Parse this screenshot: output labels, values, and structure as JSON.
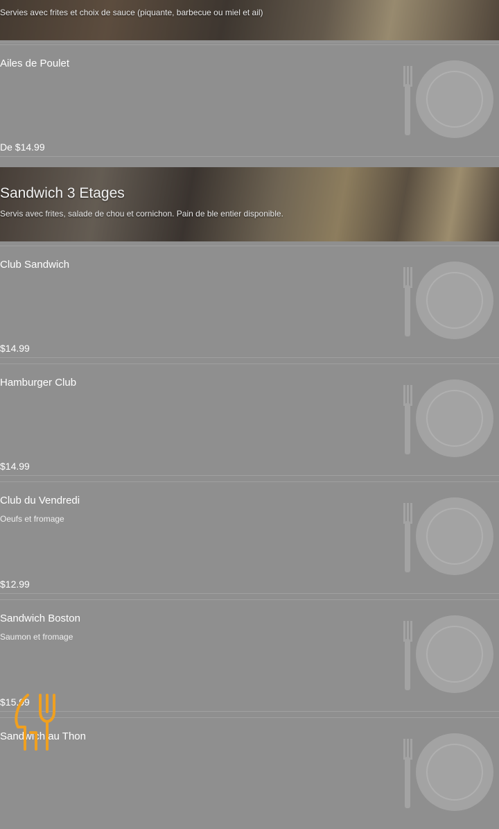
{
  "categories": [
    {
      "title": "",
      "description": "Servies avec frites et choix de sauce (piquante, barbecue ou miel et ail)"
    },
    {
      "title": "Sandwich 3 Etages",
      "description": "Servis avec frites, salade de chou et cornichon. Pain de ble entier disponible."
    }
  ],
  "items": [
    {
      "name": "Ailes de Poulet",
      "description": "",
      "price": "De $14.99"
    },
    {
      "name": "Club Sandwich",
      "description": "",
      "price": "$14.99"
    },
    {
      "name": "Hamburger Club",
      "description": "",
      "price": "$14.99"
    },
    {
      "name": "Club du Vendredi",
      "description": "Oeufs et fromage",
      "price": "$12.99"
    },
    {
      "name": "Sandwich Boston",
      "description": "Saumon et fromage",
      "price": "$15.99"
    },
    {
      "name": "Sandwich au Thon",
      "description": "",
      "price": ""
    }
  ],
  "icons": {
    "placeholder": "plate-fork-icon",
    "fab": "utensils-icon"
  },
  "colors": {
    "accent": "#f0a020",
    "overlay": "#8f8f8f"
  }
}
